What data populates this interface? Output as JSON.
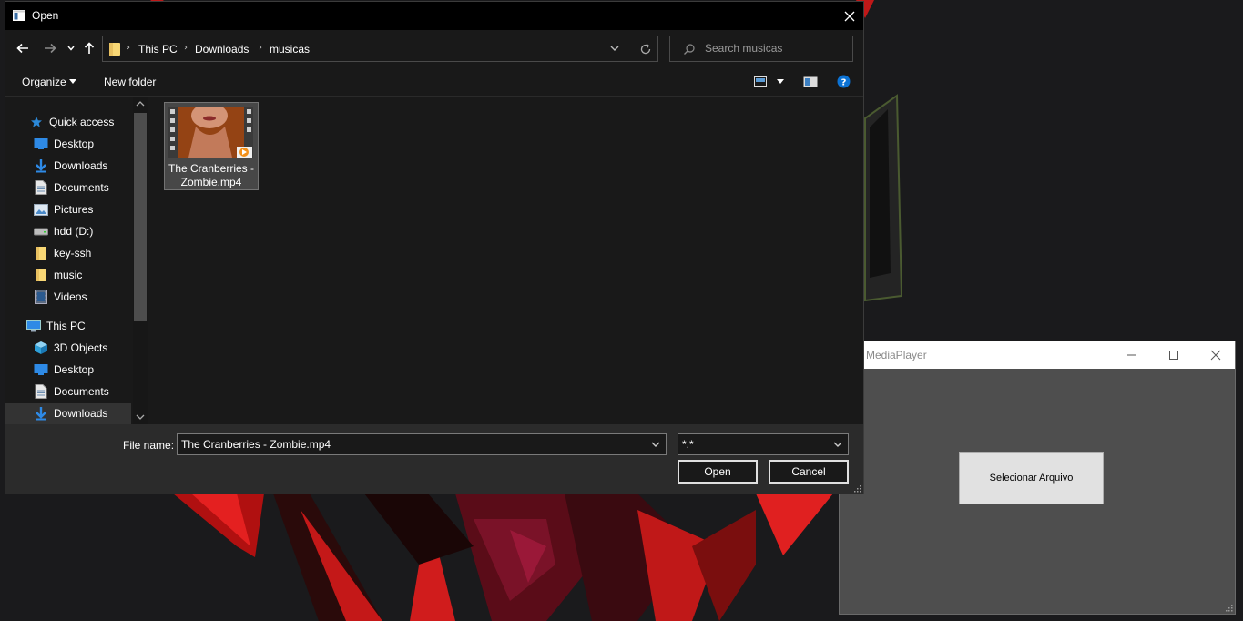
{
  "media_player": {
    "title": "MediaPlayer",
    "select_button_label": "Selecionar Arquivo"
  },
  "dialog": {
    "title": "Open",
    "breadcrumbs": [
      "This PC",
      "Downloads",
      "musicas"
    ],
    "search_placeholder": "Search musicas",
    "toolbar": {
      "organize_label": "Organize",
      "new_folder_label": "New folder"
    },
    "quick_access_label": "Quick access",
    "quick_access_items": [
      {
        "label": "Desktop",
        "icon": "desktop-icon",
        "pinned": true
      },
      {
        "label": "Downloads",
        "icon": "downloads-icon",
        "pinned": true
      },
      {
        "label": "Documents",
        "icon": "documents-icon",
        "pinned": true
      },
      {
        "label": "Pictures",
        "icon": "pictures-icon",
        "pinned": true
      },
      {
        "label": "hdd (D:)",
        "icon": "drive-icon",
        "pinned": false
      },
      {
        "label": "key-ssh",
        "icon": "folder-icon",
        "pinned": false
      },
      {
        "label": "music",
        "icon": "folder-icon",
        "pinned": false
      },
      {
        "label": "Videos",
        "icon": "videos-icon",
        "pinned": false
      }
    ],
    "this_pc_label": "This PC",
    "this_pc_items": [
      {
        "label": "3D Objects",
        "icon": "3d-objects-icon"
      },
      {
        "label": "Desktop",
        "icon": "desktop-icon"
      },
      {
        "label": "Documents",
        "icon": "documents-icon"
      },
      {
        "label": "Downloads",
        "icon": "downloads-icon",
        "selected": true
      }
    ],
    "files": [
      {
        "name_line1": "The Cranberries -",
        "name_line2": "Zombie.mp4",
        "type": "video-file"
      }
    ],
    "file_name_label": "File name:",
    "file_name_value": "The Cranberries - Zombie.mp4",
    "file_type_value": "*.*",
    "open_button_label": "Open",
    "cancel_button_label": "Cancel"
  },
  "colors": {
    "dialog_bg": "#202020",
    "titlebar_bg": "#000000",
    "mediaplayer_bg": "#4e4e4e",
    "accent_blue": "#0078d7",
    "folder_yellow": "#f8d775"
  }
}
